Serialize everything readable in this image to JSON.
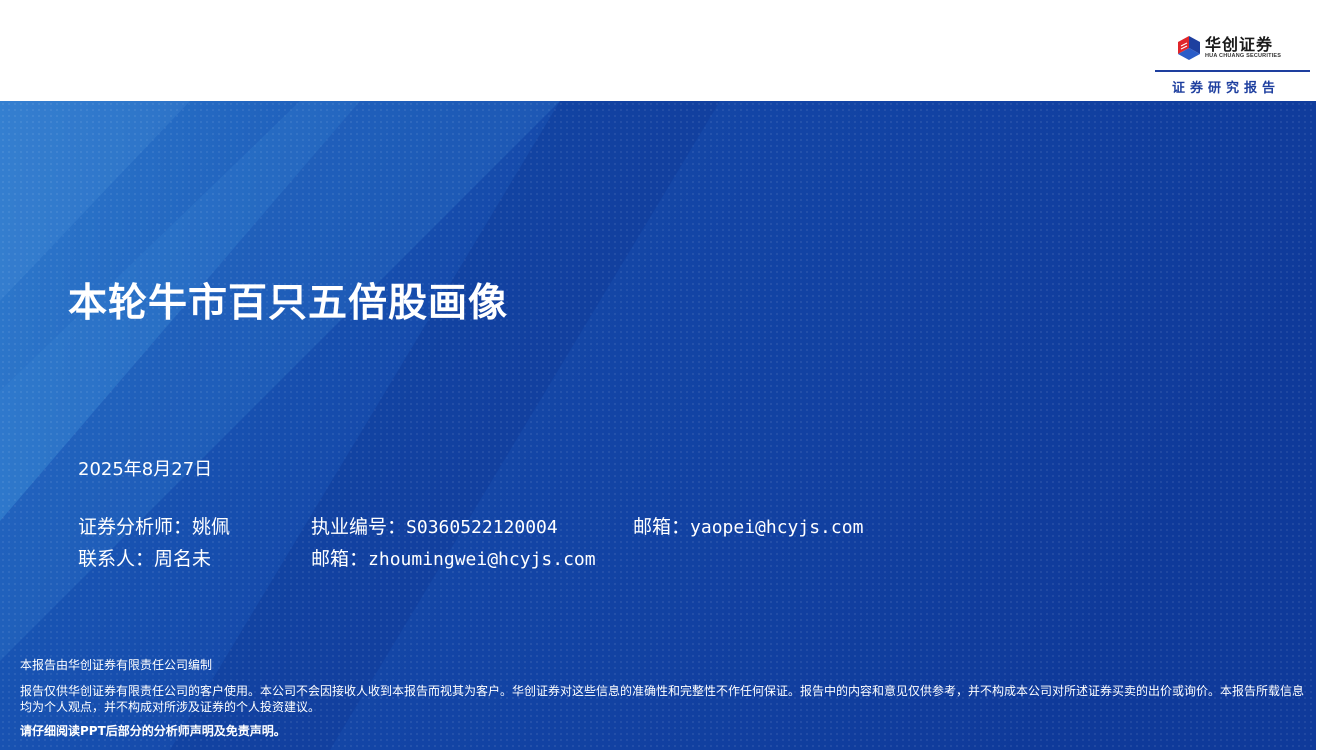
{
  "header": {
    "logo_name": "华创证券",
    "logo_en": "HUA CHUANG SECURITIES",
    "subtitle": "证券研究报告",
    "colors": {
      "brand_blue": "#1e3f9f",
      "brand_red": "#e0262b"
    }
  },
  "cover": {
    "title": "本轮牛市百只五倍股画像",
    "date": "2025年8月27日",
    "analyst_label": "证券分析师：姚佩",
    "license_label": "执业编号：",
    "license_no": "S0360522120004",
    "analyst_email_label": "邮箱：",
    "analyst_email": "yaopei@hcyjs.com",
    "contact_label": "联系人：周名未",
    "contact_email_label": "邮箱：",
    "contact_email": "zhoumingwei@hcyjs.com",
    "colors": {
      "banner_dark": "#0f3b9c",
      "banner_light": "#2f7fd0"
    }
  },
  "disclaimer": {
    "compiled_by": "本报告由华创证券有限责任公司编制",
    "body": "报告仅供华创证券有限责任公司的客户使用。本公司不会因接收人收到本报告而视其为客户。华创证券对这些信息的准确性和完整性不作任何保证。报告中的内容和意见仅供参考，并不构成本公司对所述证券买卖的出价或询价。本报告所载信息均为个人观点，并不构成对所涉及证券的个人投资建议。",
    "notice": "请仔细阅读PPT后部分的分析师声明及免责声明。"
  }
}
